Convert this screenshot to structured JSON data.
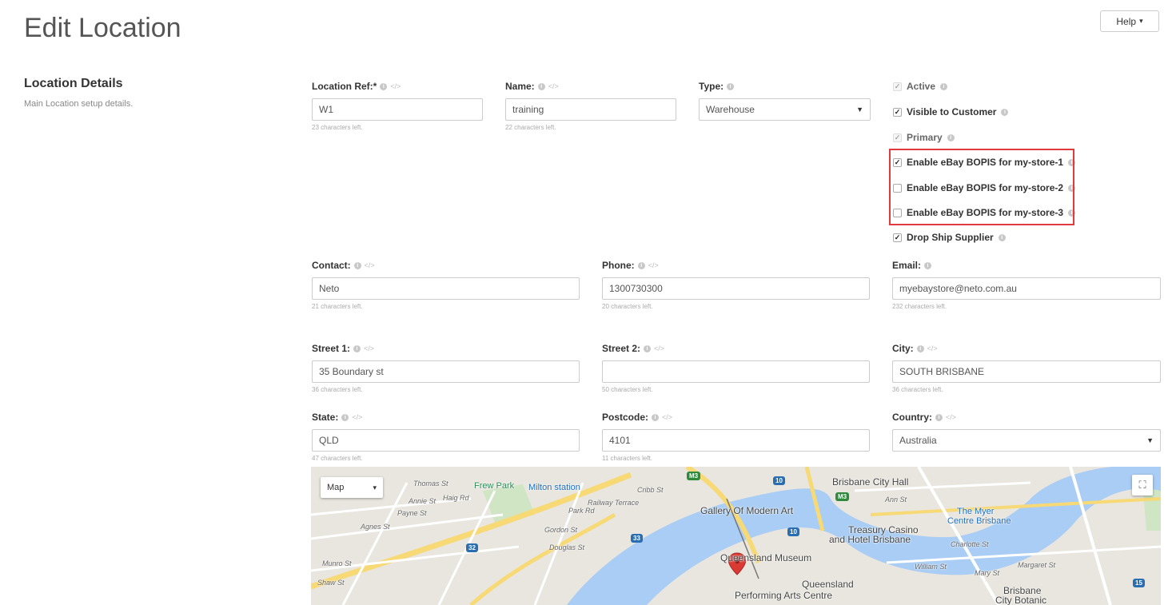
{
  "page": {
    "title": "Edit Location"
  },
  "header": {
    "help_label": "Help"
  },
  "section": {
    "title": "Location Details",
    "description": "Main Location setup details."
  },
  "fields": {
    "location_ref": {
      "label": "Location Ref:*",
      "value": "W1",
      "hint": "23 characters left."
    },
    "name": {
      "label": "Name:",
      "value": "training",
      "hint": "22 characters left."
    },
    "type": {
      "label": "Type:",
      "value": "Warehouse"
    },
    "contact": {
      "label": "Contact:",
      "value": "Neto",
      "hint": "21 characters left."
    },
    "phone": {
      "label": "Phone:",
      "value": "1300730300",
      "hint": "20 characters left."
    },
    "email": {
      "label": "Email:",
      "value": "myebaystore@neto.com.au",
      "hint": "232 characters left."
    },
    "street1": {
      "label": "Street 1:",
      "value": "35 Boundary st",
      "hint": "36 characters left."
    },
    "street2": {
      "label": "Street 2:",
      "value": "",
      "hint": "50 characters left."
    },
    "city": {
      "label": "City:",
      "value": "SOUTH BRISBANE",
      "hint": "36 characters left."
    },
    "state": {
      "label": "State:",
      "value": "QLD",
      "hint": "47 characters left."
    },
    "postcode": {
      "label": "Postcode:",
      "value": "4101",
      "hint": "11 characters left."
    },
    "country": {
      "label": "Country:",
      "value": "Australia"
    }
  },
  "checkboxes": [
    {
      "label": "Active",
      "checked": true,
      "disabled": true
    },
    {
      "label": "Visible to Customer",
      "checked": true,
      "disabled": false
    },
    {
      "label": "Primary",
      "checked": true,
      "disabled": true
    },
    {
      "label": "Enable eBay BOPIS for my-store-1",
      "checked": true,
      "disabled": false
    },
    {
      "label": "Enable eBay BOPIS for my-store-2",
      "checked": false,
      "disabled": false
    },
    {
      "label": "Enable eBay BOPIS for my-store-3",
      "checked": false,
      "disabled": false
    },
    {
      "label": "Drop Ship Supplier",
      "checked": true,
      "disabled": false
    }
  ],
  "map": {
    "type_label": "Map",
    "labels": {
      "frew_park": "Frew Park",
      "milton_station": "Milton station",
      "thomas_st": "Thomas St",
      "annie_st": "Annie St",
      "haig_rd": "Haig Rd",
      "payne_st": "Payne St",
      "agnes_st": "Agnes St",
      "munro_st": "Munro St",
      "shaw_st": "Shaw St",
      "railway_terrace": "Railway Terrace",
      "cribb_st": "Cribb St",
      "park_rd": "Park Rd",
      "gordon_st": "Gordon St",
      "douglas_st": "Douglas St",
      "gallery": "Gallery Of Modern Art",
      "museum": "Queensland Museum",
      "qpac_1": "Queensland",
      "qpac_2": "Performing Arts Centre",
      "city_hall": "Brisbane City Hall",
      "ann_st": "Ann St",
      "myer_1": "The Myer",
      "myer_2": "Centre Brisbane",
      "casino_1": "Treasury Casino",
      "casino_2": "and Hotel Brisbane",
      "william_st": "William St",
      "charlotte_st": "Charlotte St",
      "mary_st": "Mary St",
      "margaret_st": "Margaret St",
      "botanic_1": "Brisbane",
      "botanic_2": "City Botanic"
    },
    "shields": {
      "m3": "M3",
      "r10": "10",
      "r32": "32",
      "r33": "33",
      "r15": "15"
    }
  },
  "colors": {
    "highlight_border": "#e03a3e",
    "water": "#a9cdf4",
    "major_road": "#f7d976",
    "pin": "#d93a32"
  }
}
